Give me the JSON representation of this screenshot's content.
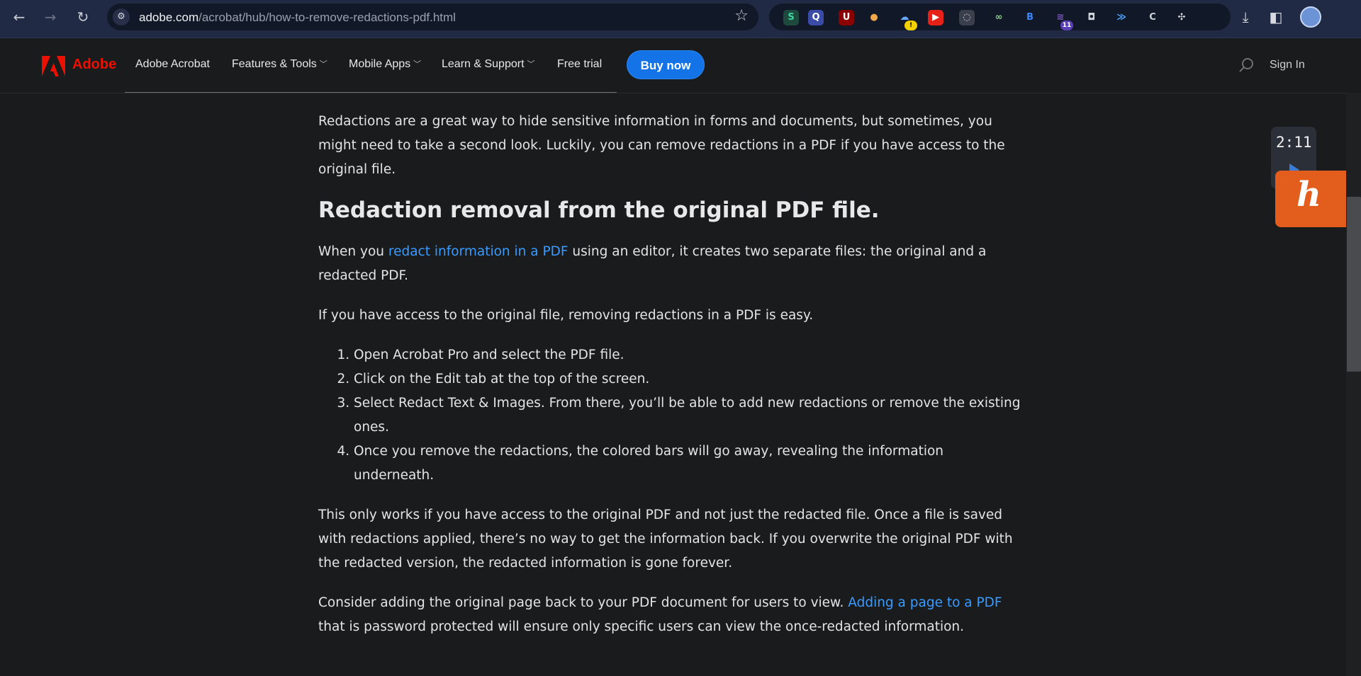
{
  "browser": {
    "url_host": "adobe.com",
    "url_path": "/acrobat/hub/how-to-remove-redactions-pdf.html",
    "extensions": [
      {
        "name": "s-extension-icon",
        "glyph": "S",
        "bg": "#1d4a3c",
        "fg": "#3fd3a0"
      },
      {
        "name": "q-extension-icon",
        "glyph": "Q",
        "bg": "#3b4ba8",
        "fg": "#ffffff"
      },
      {
        "name": "ublock-extension-icon",
        "glyph": "U",
        "bg": "#8b0000",
        "fg": "#ffffff"
      },
      {
        "name": "orange-extension-icon",
        "glyph": "●",
        "bg": "#111827",
        "fg": "#f0a64a"
      },
      {
        "name": "cloud-extension-icon",
        "glyph": "☁",
        "bg": "#111827",
        "fg": "#6aa8ff",
        "badge": "!"
      },
      {
        "name": "youtube-extension-icon",
        "glyph": "▶",
        "bg": "#e62117",
        "fg": "#ffffff"
      },
      {
        "name": "circle-extension-icon",
        "glyph": "◌",
        "bg": "#3a3f4b",
        "fg": "#d6d9e0"
      },
      {
        "name": "glasses-extension-icon",
        "glyph": "∞",
        "bg": "#111827",
        "fg": "#8ed08e"
      },
      {
        "name": "b-extension-icon",
        "glyph": "B",
        "bg": "#111827",
        "fg": "#3a86ff"
      },
      {
        "name": "stack-extension-icon",
        "glyph": "≋",
        "bg": "#111827",
        "fg": "#7e57c2",
        "badge": "11"
      },
      {
        "name": "camera-extension-icon",
        "glyph": "◘",
        "bg": "#111827",
        "fg": "#cfd3da"
      },
      {
        "name": "wave-extension-icon",
        "glyph": "≫",
        "bg": "#111827",
        "fg": "#4aa3ff"
      },
      {
        "name": "c-extension-icon",
        "glyph": "C",
        "bg": "#111827",
        "fg": "#cfd3da"
      },
      {
        "name": "puzzle-extension-icon",
        "glyph": "✣",
        "bg": "#111827",
        "fg": "#d6d9e0"
      }
    ]
  },
  "header": {
    "brand": "Adobe",
    "nav": {
      "acrobat": "Adobe Acrobat",
      "features": "Features & Tools",
      "mobile": "Mobile Apps",
      "learn": "Learn & Support",
      "trial": "Free trial"
    },
    "buy": "Buy now",
    "sign_in": "Sign In"
  },
  "article": {
    "intro": "Redactions are a great way to hide sensitive information in forms and documents, but sometimes, you might need to take a second look. Luckily, you can remove redactions in a PDF if you have access to the original file.",
    "heading": "Redaction removal from the original PDF file.",
    "p2_before": "When you ",
    "p2_link": "redact information in a PDF",
    "p2_after": " using an editor, it creates two separate files: the original and a redacted PDF.",
    "p3": "If you have access to the original file, removing redactions in a PDF is easy.",
    "steps": [
      "Open Acrobat Pro and select the PDF file.",
      "Click on the Edit tab at the top of the screen.",
      "Select Redact Text & Images. From there, you’ll be able to add new redactions or remove the existing ones.",
      "Once you remove the redactions, the colored bars will go away, revealing the information underneath."
    ],
    "p4": "This only works if you have access to the original PDF and not just the redacted file. Once a file is saved with redactions applied, there’s no way to get the information back. If you overwrite the original PDF with the redacted version, the redacted information is gone forever.",
    "p5_before": "Consider adding the original page back to your PDF document for users to view. ",
    "p5_link": "Adding a page to a PDF",
    "p5_after": " that is password protected will ensure only specific users can view the once-redacted information."
  },
  "widgets": {
    "timer": "2:11"
  }
}
